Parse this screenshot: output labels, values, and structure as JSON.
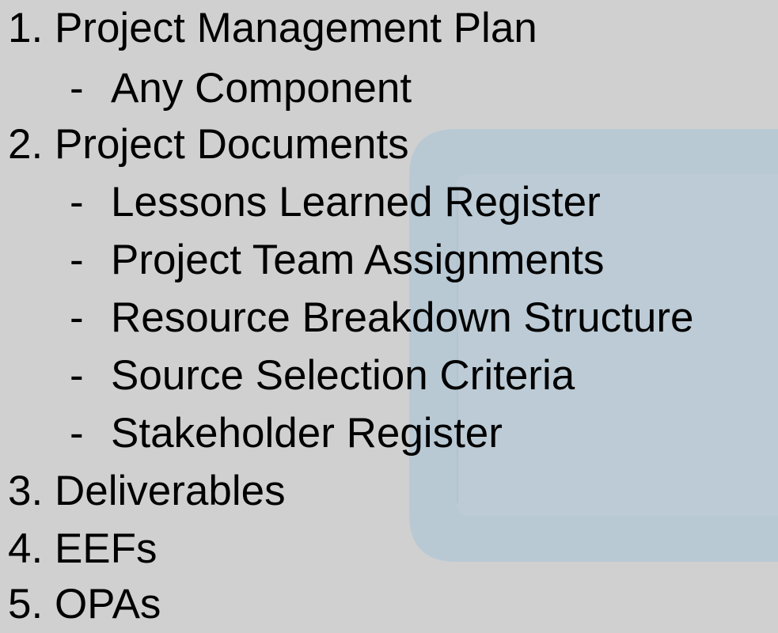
{
  "slide": {
    "items": [
      {
        "marker": "1.",
        "text": "Project Management Plan",
        "subitems": [
          {
            "marker": "-",
            "text": "Any Component"
          }
        ]
      },
      {
        "marker": "2.",
        "text": "Project Documents",
        "subitems": [
          {
            "marker": "-",
            "text": "Lessons Learned Register"
          },
          {
            "marker": "-",
            "text": "Project Team Assignments"
          },
          {
            "marker": "-",
            "text": "Resource Breakdown Structure"
          },
          {
            "marker": "-",
            "text": "Source Selection Criteria"
          },
          {
            "marker": "-",
            "text": "Stakeholder Register"
          }
        ]
      },
      {
        "marker": "3.",
        "text": "Deliverables",
        "subitems": []
      },
      {
        "marker": "4.",
        "text": "EEFs",
        "subitems": []
      },
      {
        "marker": "5.",
        "text": "OPAs",
        "subitems": []
      }
    ]
  },
  "colors": {
    "background": "#d0d0d0",
    "watermark": "#b8c9d4",
    "text": "#000000"
  }
}
